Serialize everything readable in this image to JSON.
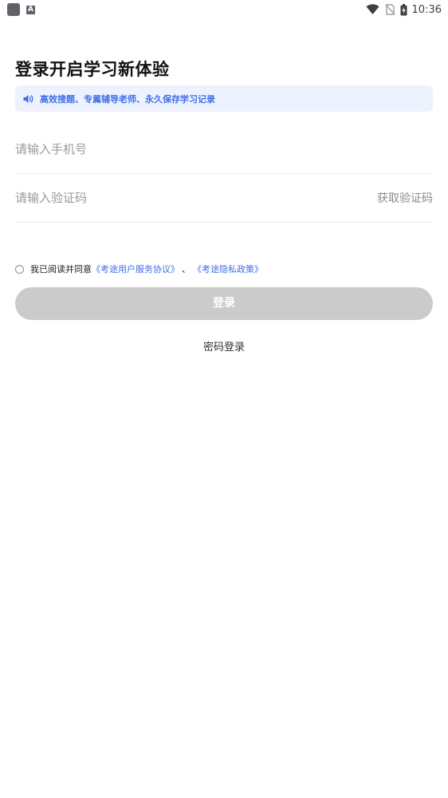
{
  "status_bar": {
    "time": "10:36",
    "left_icons": [
      "app-icon",
      "a-icon"
    ],
    "a_icon_glyph": "A",
    "right_icons": [
      "wifi-icon",
      "no-sim-icon",
      "battery-charging-icon"
    ]
  },
  "title": "登录开启学习新体验",
  "notice": {
    "icon": "speaker-icon",
    "text": "高效搜题、专属辅导老师、永久保存学习记录",
    "color": "#3f6fe6",
    "background": "#edf2fe"
  },
  "phone_field": {
    "placeholder": "请输入手机号",
    "value": ""
  },
  "code_field": {
    "placeholder": "请输入验证码",
    "value": "",
    "get_code_label": "获取验证码"
  },
  "agreement": {
    "checked": false,
    "prefix": "我已阅读并同意",
    "link1": "《考途用户服务协议》",
    "separator": "、",
    "link2": "《考途隐私政策》"
  },
  "login_button": {
    "label": "登录",
    "background": "#cbcbcb"
  },
  "password_login": "密码登录"
}
